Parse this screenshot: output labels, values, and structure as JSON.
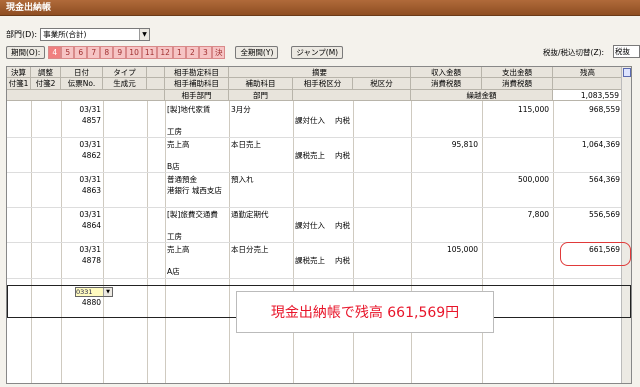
{
  "window": {
    "title": "現金出納帳"
  },
  "department": {
    "label": "部門(D):",
    "value": "事業所(合計)"
  },
  "period": {
    "button_label": "期間(O):",
    "months": [
      "4",
      "5",
      "6",
      "7",
      "8",
      "9",
      "10",
      "11",
      "12",
      "1",
      "2",
      "3",
      "決"
    ],
    "all_period_label": "全期間(Y)",
    "jump_label": "ジャンプ(M)"
  },
  "tax": {
    "label": "税抜/税込切替(Z):",
    "value": "税抜"
  },
  "table": {
    "headers": {
      "h1": [
        "決算",
        "調整",
        "日付",
        "タイプ",
        "相手勘定科目",
        "摘要",
        "収入金額",
        "支出金額",
        "残高"
      ],
      "h2": [
        "付箋1",
        "付箋2",
        "伝票No.",
        "生成元",
        "相手補助科目",
        "補助科目",
        "相手税区分",
        "税区分",
        "消費税額",
        "消費税額"
      ],
      "h3": [
        "相手部門",
        "部門",
        "繰越金額"
      ]
    },
    "opening_balance": "1,083,559",
    "entries": [
      {
        "date": "03/31",
        "slip": "4857",
        "account": "[製]地代家賃",
        "memo": "3月分",
        "tax_type": "課対仕入",
        "tax_rate": "内税",
        "dept": "工房",
        "income": "",
        "expense": "115,000",
        "balance": "968,559"
      },
      {
        "date": "03/31",
        "slip": "4862",
        "account": "売上高",
        "memo": "本日売上",
        "tax_type": "課税売上",
        "tax_rate": "内税",
        "dept": "B店",
        "income": "95,810",
        "expense": "",
        "balance": "1,064,369"
      },
      {
        "date": "03/31",
        "slip": "4863",
        "account": "普通預金",
        "memo": "預入れ",
        "sub": "港銀行 城西支店",
        "tax_type": "",
        "tax_rate": "",
        "dept": "",
        "income": "",
        "expense": "500,000",
        "balance": "564,369"
      },
      {
        "date": "03/31",
        "slip": "4864",
        "account": "[製]旅費交通費",
        "memo": "通勤定期代",
        "tax_type": "課対仕入",
        "tax_rate": "内税",
        "dept": "工房",
        "income": "",
        "expense": "7,800",
        "balance": "556,569"
      },
      {
        "date": "03/31",
        "slip": "4878",
        "account": "売上高",
        "memo": "本日分売上",
        "tax_type": "課税売上",
        "tax_rate": "内税",
        "dept": "A店",
        "income": "105,000",
        "expense": "",
        "balance": "661,569"
      }
    ],
    "new_row": {
      "date": "0331",
      "slip": "4880"
    }
  },
  "annotation": {
    "text": "現金出納帳で残高 661,569円",
    "color": "#e8152a"
  },
  "icons": {
    "sidebar_icon": "calendar-icon"
  }
}
